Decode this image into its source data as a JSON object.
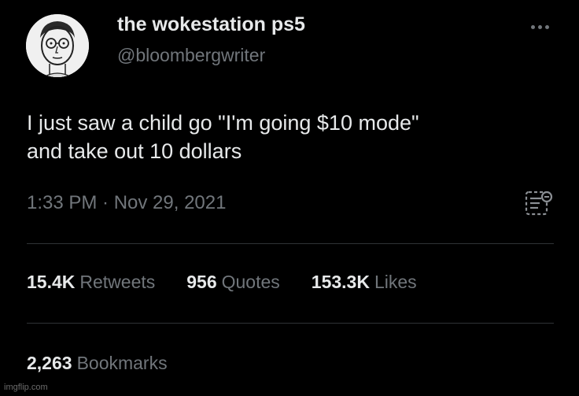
{
  "author": {
    "display_name": "the wokestation ps5",
    "handle": "@bloombergwriter",
    "avatar_icon": "avatar-illustration"
  },
  "tweet": {
    "text_lines": [
      "I just saw a child go \"I'm going $10 mode\"",
      "and take out 10 dollars"
    ],
    "timestamp": "1:33 PM · Nov 29, 2021"
  },
  "stats": {
    "retweets": {
      "value": "15.4K",
      "label": "Retweets"
    },
    "quotes": {
      "value": "956",
      "label": "Quotes"
    },
    "likes": {
      "value": "153.3K",
      "label": "Likes"
    },
    "bookmarks": {
      "value": "2,263",
      "label": "Bookmarks"
    }
  },
  "icons": {
    "more": "more-options-icon",
    "analytics": "analytics-icon"
  },
  "colors": {
    "background": "#000000",
    "primary_text": "#e7e9ea",
    "secondary_text": "#71767b",
    "divider": "#2f3336"
  },
  "watermark": "imgflip.com"
}
